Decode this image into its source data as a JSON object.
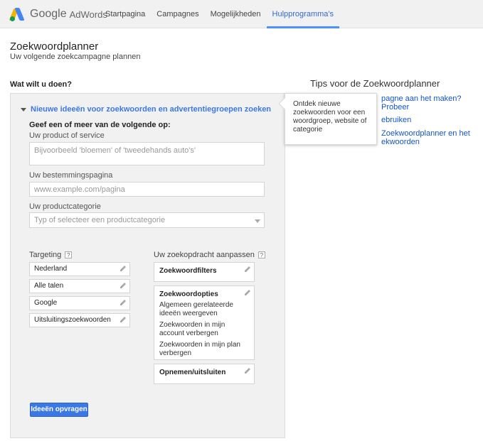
{
  "header": {
    "logo_google": "Google",
    "logo_adwords": "AdWords",
    "nav": [
      {
        "label": "Startpagina",
        "active": false
      },
      {
        "label": "Campagnes",
        "active": false
      },
      {
        "label": "Mogelijkheden",
        "active": false
      },
      {
        "label": "Hulpprogramma's",
        "active": true
      }
    ]
  },
  "page": {
    "title": "Zoekwoordplanner",
    "subtitle": "Uw volgende zoekcampagne plannen",
    "section_label": "Wat wilt u doen?"
  },
  "panel": {
    "heading": "Nieuwe ideeën voor zoekwoorden en advertentiegroepen zoeken",
    "instruction": "Geef een of meer van de volgende op:",
    "product_label": "Uw product of service",
    "product_placeholder": "Bijvoorbeeld 'bloemen' of 'tweedehands auto's'",
    "landing_label": "Uw bestemmingspagina",
    "landing_placeholder": "www.example.com/pagina",
    "category_label": "Uw productcategorie",
    "category_placeholder": "Typ of selecteer een productcategorie",
    "targeting": {
      "label": "Targeting",
      "help": "?",
      "items": [
        "Nederland",
        "Alle talen",
        "Google",
        "Uitsluitingszoekwoorden"
      ]
    },
    "customize": {
      "label": "Uw zoekopdracht aanpassen",
      "help": "?",
      "filters_title": "Zoekwoordfilters",
      "options_title": "Zoekwoordopties",
      "options": [
        "Algemeen gerelateerde ideeën weergeven",
        "Zoekwoorden in mijn account verbergen",
        "Zoekwoorden in mijn plan verbergen"
      ],
      "include_title": "Opnemen/uitsluiten"
    },
    "submit_label": "Ideeën opvragen"
  },
  "tips": {
    "title": "Tips voor de Zoekwoordplanner",
    "links": [
      "pagne aan het maken? Probeer",
      "ebruiken",
      "Zoekwoordplanner en het",
      "ekwoorden"
    ]
  },
  "tooltip": {
    "text": "Ontdek nieuwe zoekwoorden voor een woordgroep, website of categorie"
  },
  "colors": {
    "accent": "#3b78e7",
    "link": "#1155cc",
    "panel_bg": "#f1f1f1"
  }
}
